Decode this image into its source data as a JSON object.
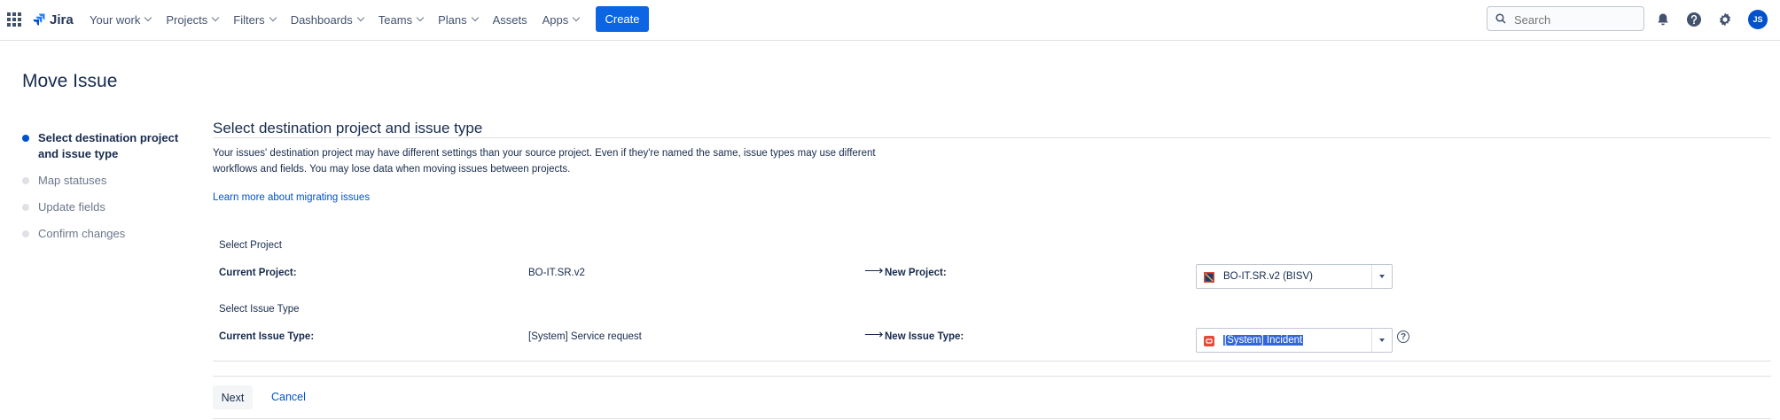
{
  "nav": {
    "logo": "Jira",
    "items": [
      "Your work",
      "Projects",
      "Filters",
      "Dashboards",
      "Teams",
      "Plans",
      "Assets",
      "Apps"
    ],
    "create": "Create",
    "search_placeholder": "Search",
    "avatar_initials": "JS"
  },
  "page": {
    "title": "Move Issue",
    "steps": [
      {
        "label": "Select destination project and issue type",
        "active": true
      },
      {
        "label": "Map statuses",
        "active": false
      },
      {
        "label": "Update fields",
        "active": false
      },
      {
        "label": "Confirm changes",
        "active": false
      }
    ]
  },
  "form": {
    "section_title": "Select destination project and issue type",
    "description": "Your issues' destination project may have different settings than your source project. Even if they're named the same, issue types may use different workflows and fields. You may lose data when moving issues between projects.",
    "learn_link": "Learn more about migrating issues",
    "project": {
      "section_label": "Select Project",
      "current_label": "Current Project:",
      "current_value": "BO-IT.SR.v2",
      "arrow": "⟶",
      "new_label": "New Project:",
      "new_value": "BO-IT.SR.v2 (BISV)"
    },
    "issue_type": {
      "section_label": "Select Issue Type",
      "current_label": "Current Issue Type:",
      "current_value": "[System] Service request",
      "arrow": "⟶",
      "new_label": "New Issue Type:",
      "new_value": "[System] Incident",
      "help": "?"
    },
    "next": "Next",
    "cancel": "Cancel"
  },
  "colors": {
    "primary": "#0c66e4",
    "link": "#0052cc",
    "text": "#172b4d",
    "incident": "#e5493a"
  }
}
